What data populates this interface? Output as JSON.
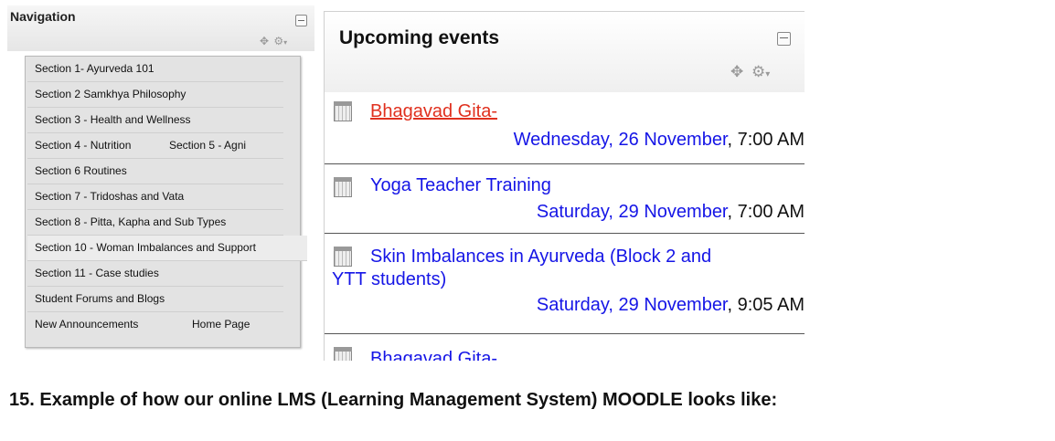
{
  "navigation": {
    "title": "Navigation",
    "rows": [
      [
        "Section 1- Ayurveda 101"
      ],
      [
        "Section 2 Samkhya Philosophy"
      ],
      [
        "Section 3 - Health and Wellness"
      ],
      [
        "Section 4 - Nutrition",
        "Section 5 - Agni"
      ],
      [
        "Section 6 Routines"
      ],
      [
        "Section 7 - Tridoshas and Vata"
      ],
      [
        "Section 8 - Pitta, Kapha and Sub Types"
      ],
      [
        "Section 10 - Woman Imbalances and Support"
      ],
      [
        "Section 11 - Case studies"
      ],
      [
        "Student Forums and Blogs"
      ],
      [
        "New Announcements",
        "Home Page"
      ]
    ]
  },
  "events": {
    "title": "Upcoming events",
    "items": [
      {
        "name": "Bhagavad Gita-",
        "day": "Wednesday, 26 November",
        "time": ", 7:00 AM",
        "highlight": true
      },
      {
        "name": "Yoga Teacher Training",
        "day": "Saturday, 29 November",
        "time": ", 7:00 AM"
      },
      {
        "name": "Skin Imbalances in Ayurveda (Block 2 and",
        "name2": "YTT students)",
        "day": "Saturday, 29 November",
        "time": ", 9:05 AM"
      },
      {
        "name": "Bhagavad Gita-"
      }
    ]
  },
  "icons": {
    "collapse": "collapse-icon",
    "move": "move-icon",
    "actions": "gear-icon",
    "calendar": "calendar-icon"
  },
  "caption": "15. Example of how our online LMS (Learning Management System) MOODLE looks like:"
}
